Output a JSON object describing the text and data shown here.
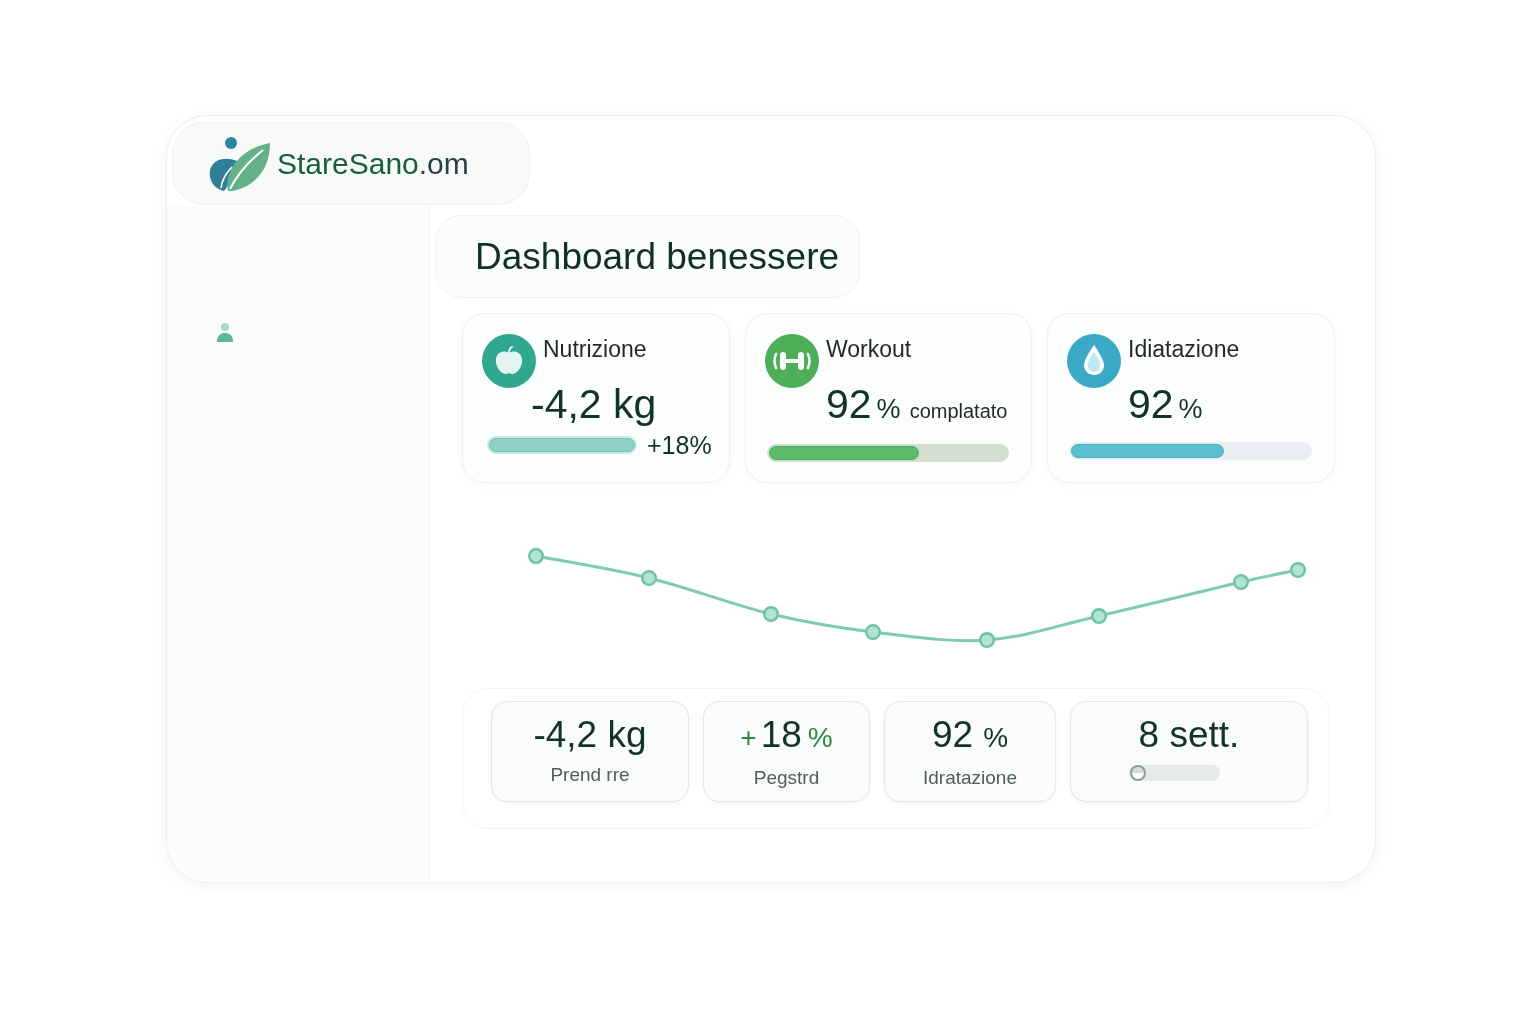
{
  "brand": {
    "name": "StareSano",
    "domain": ".om"
  },
  "title": "Dashboard benessere",
  "metrics": [
    {
      "kind": "nutrition",
      "label": "Nutrizione",
      "color": "#2fa88f",
      "value": "-4,2 kg",
      "level": 1,
      "reading": "+18%"
    },
    {
      "kind": "workout",
      "label": "Workout",
      "color": "#4daf57",
      "value": "92",
      "unit": "%",
      "note": "complatato",
      "level": 0.63
    },
    {
      "kind": "hydration",
      "label": "Idiatazione",
      "color": "#3aa9c6",
      "value": "92",
      "unit": "%",
      "level": 0.64
    }
  ],
  "summary": [
    {
      "kind": "plain",
      "value": "-4,2 kg",
      "label": "Prend rre"
    },
    {
      "kind": "change",
      "sign": "+",
      "value": "18",
      "unit": "%",
      "label": "Pegstrd"
    },
    {
      "kind": "percent",
      "value": "92",
      "unit": "%",
      "label": "Idratazione"
    },
    {
      "kind": "slider",
      "value": "8 sett.",
      "level": 0.1
    }
  ]
}
